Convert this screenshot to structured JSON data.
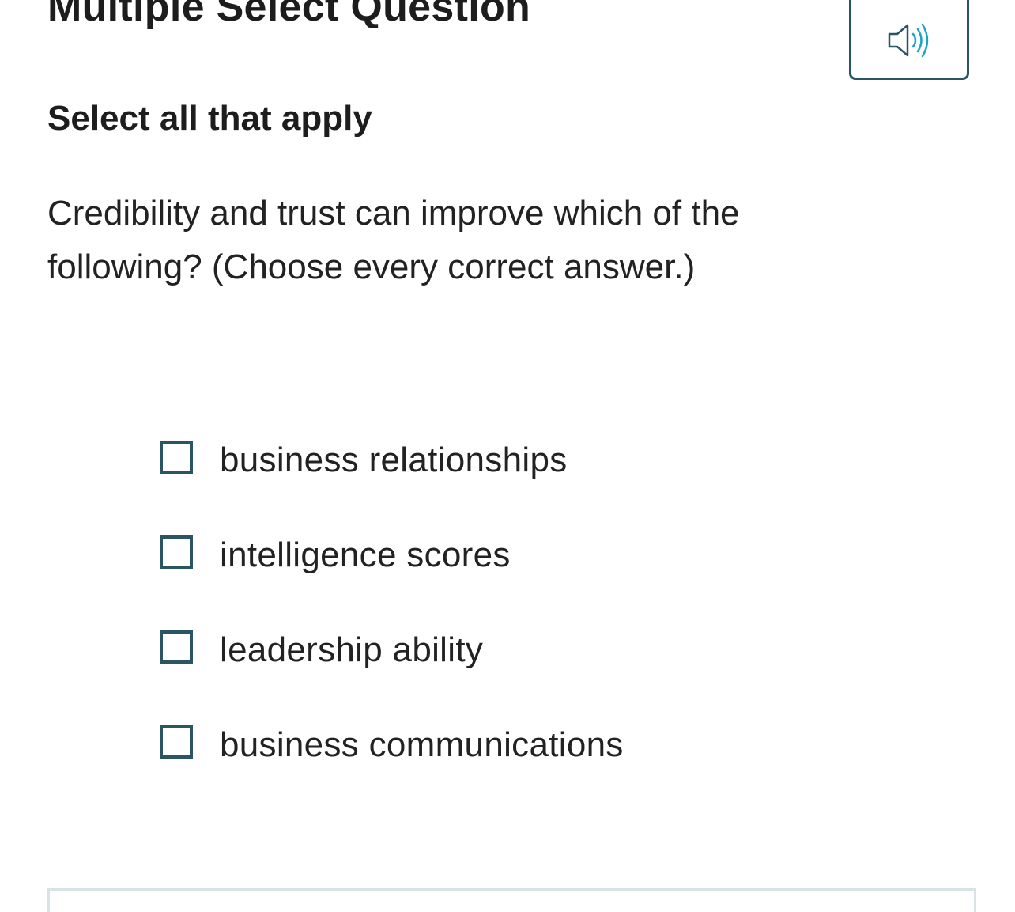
{
  "question": {
    "type_label": "Multiple Select Question",
    "instruction": "Select all that apply",
    "prompt": "Credibility and trust can improve which of the following? (Choose every correct answer.)"
  },
  "audio_button": {
    "icon": "speaker-icon"
  },
  "options": [
    {
      "label": "business relationships",
      "checked": false
    },
    {
      "label": "intelligence scores",
      "checked": false
    },
    {
      "label": "leadership ability",
      "checked": false
    },
    {
      "label": "business communications",
      "checked": false
    }
  ],
  "colors": {
    "accent": "#2a5563",
    "audio_waves": "#1aa3c4",
    "text": "#222222",
    "panel_border": "#d7e3e5"
  }
}
